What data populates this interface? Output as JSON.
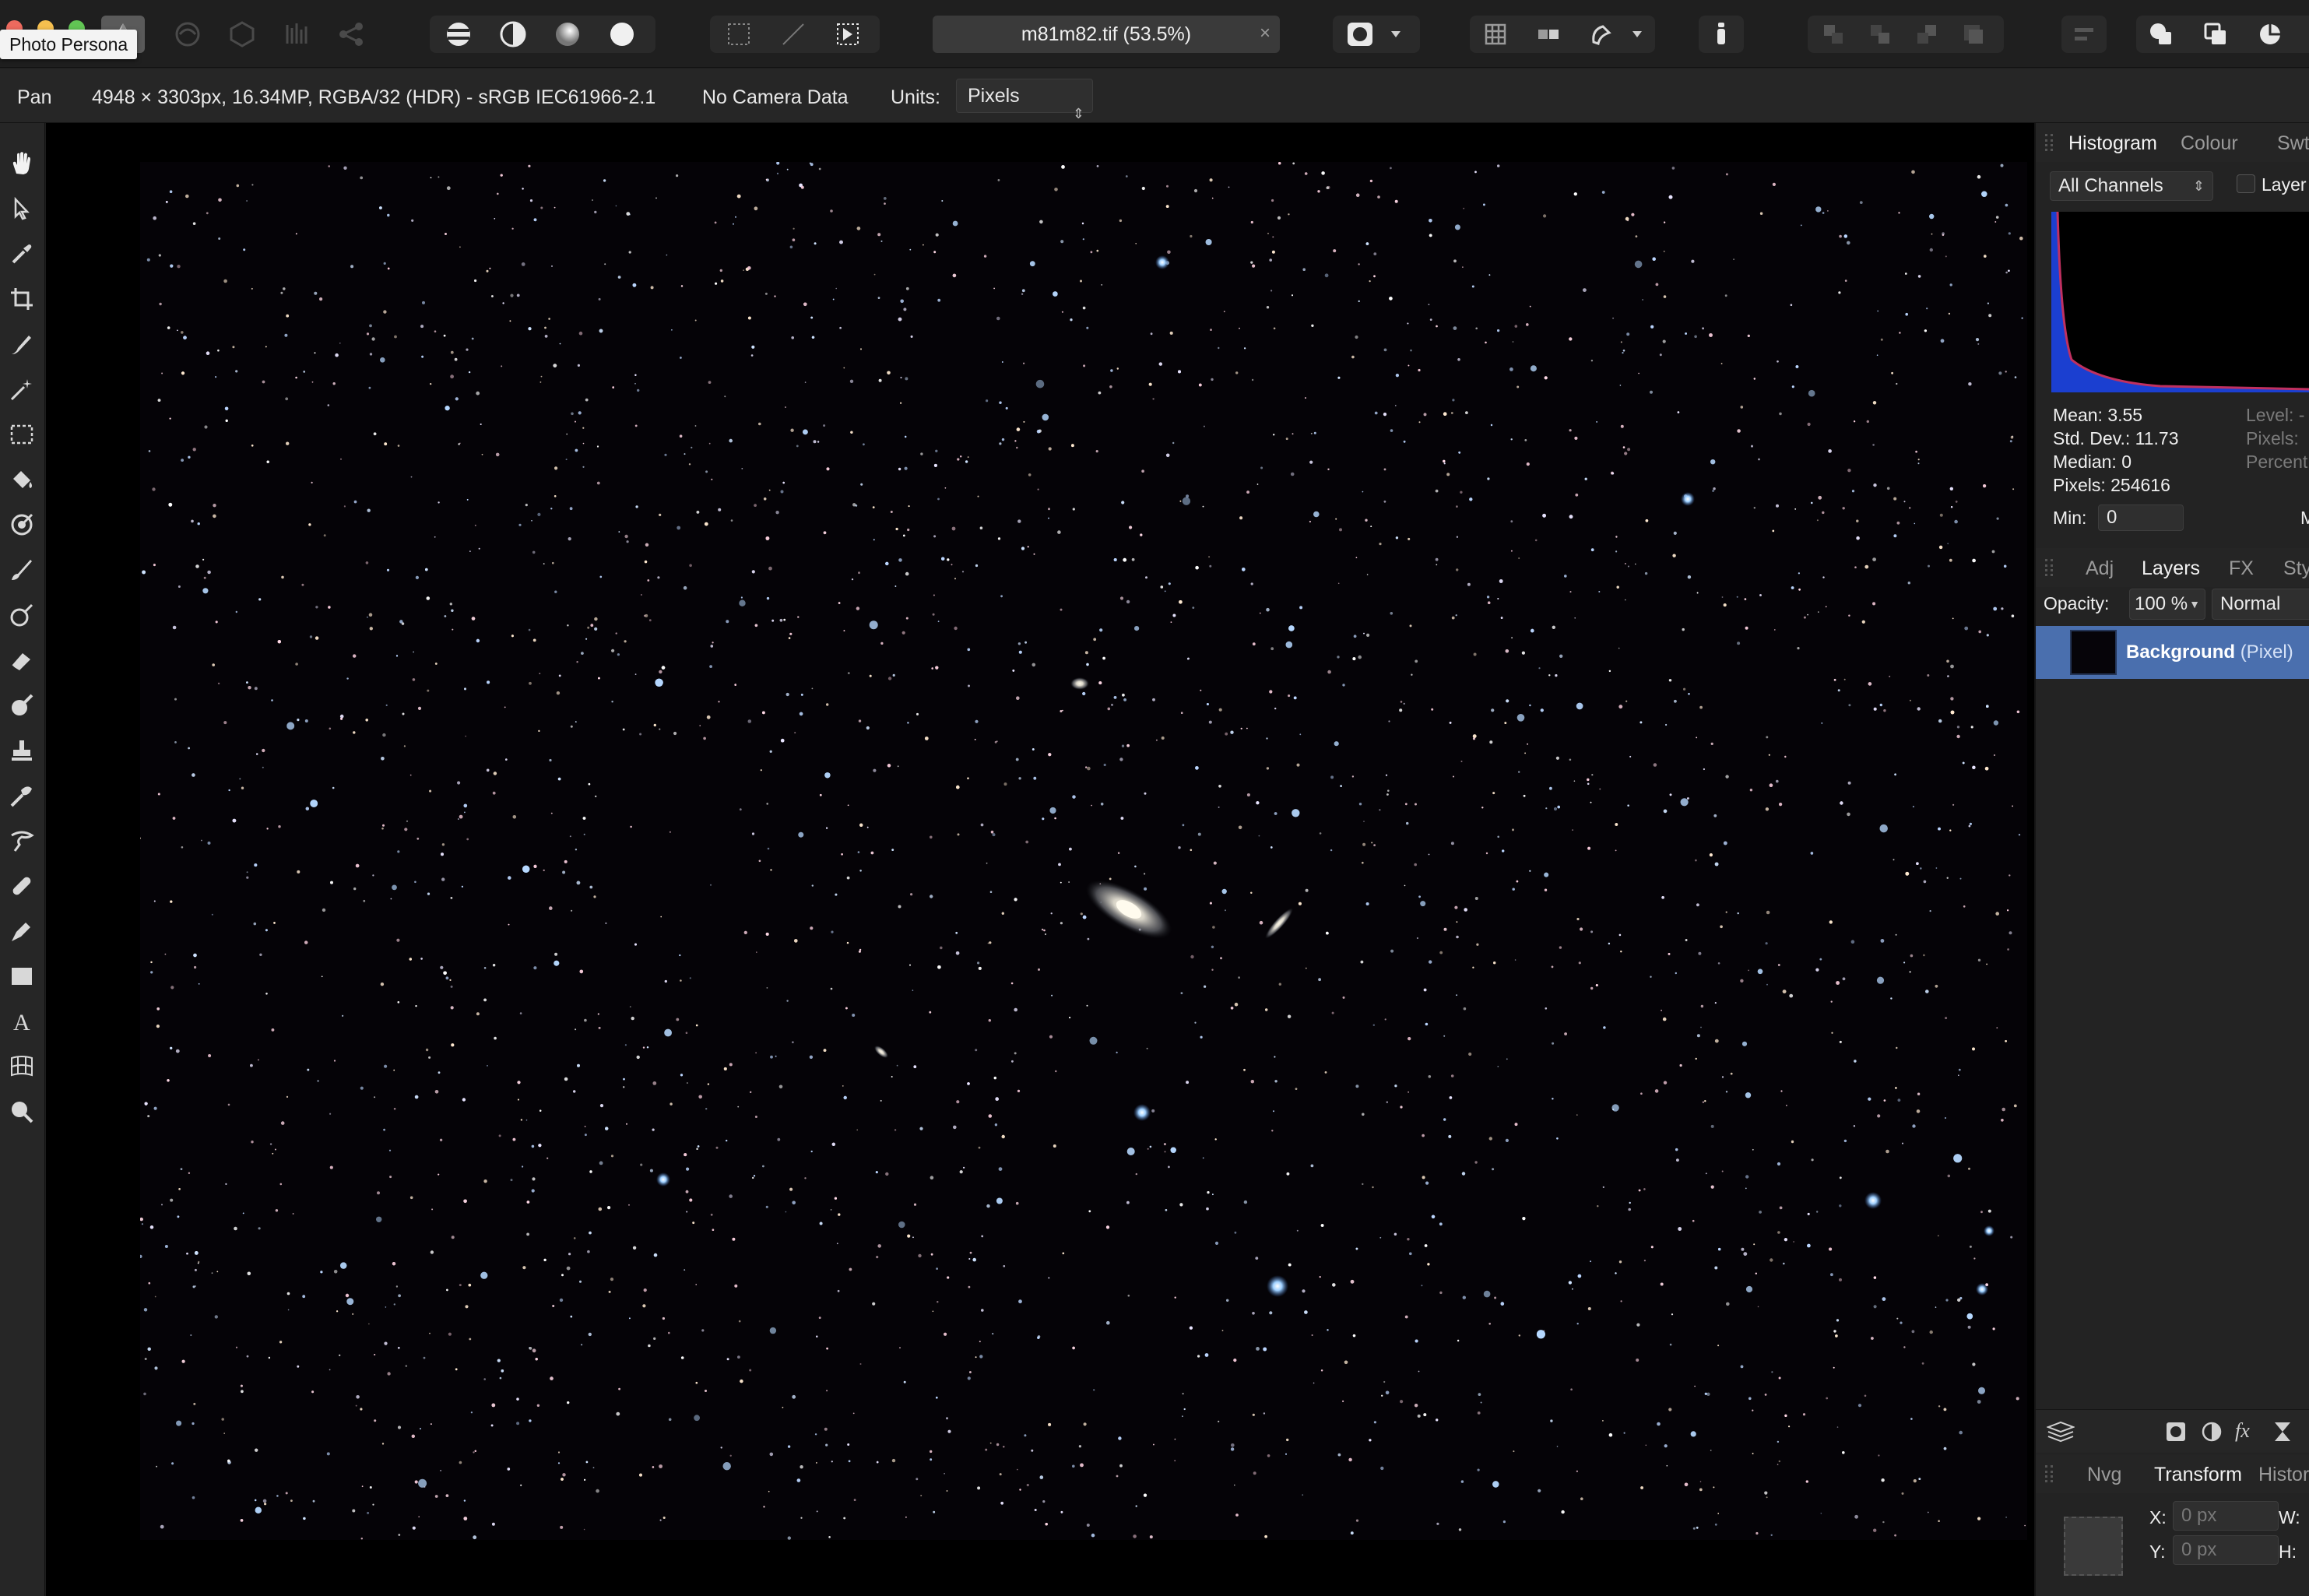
{
  "app": {
    "persona_label": "Photo Persona",
    "document_title": "m81m82.tif (53.5%)",
    "document_close": "×"
  },
  "context_bar": {
    "tool_name": "Pan",
    "image_info": "4948 × 3303px, 16.34MP, RGBA/32 (HDR) - sRGB IEC61966-2.1",
    "camera": "No Camera Data",
    "units_label": "Units:",
    "units_value": "Pixels"
  },
  "tools": [
    "hand-tool",
    "move-tool",
    "color-picker-tool",
    "crop-tool",
    "selection-brush-tool",
    "magic-wand-tool",
    "marquee-tool",
    "flood-fill-tool",
    "color-replace-tool",
    "paint-brush-tool",
    "dodge-tool",
    "erase-brush-tool",
    "blur-brush-tool",
    "clone-tool",
    "smudge-tool",
    "liquify-tool",
    "healing-brush-tool",
    "pen-tool",
    "rectangle-tool",
    "text-tool",
    "mesh-warp-tool",
    "zoom-tool"
  ],
  "histogram_panel": {
    "tabs": [
      "Histogram",
      "Colour",
      "Swt"
    ],
    "channel_select": "All Channels",
    "layer_checkbox_label": "Layer",
    "stats": {
      "mean": "Mean: 3.55",
      "std_dev": "Std. Dev.: 11.73",
      "median": "Median: 0",
      "pixels": "Pixels: 254616"
    },
    "right_stats": {
      "level": "Level: -",
      "pixels": "Pixels:",
      "percent": "Percent"
    },
    "min_label": "Min:",
    "min_value": "0",
    "max_label_partial": "M"
  },
  "layers_panel": {
    "tabs": [
      "Adj",
      "Layers",
      "FX",
      "Sty"
    ],
    "opacity_label": "Opacity:",
    "opacity_value": "100 %",
    "blend_mode": "Normal",
    "layer": {
      "name": "Background",
      "type": "(Pixel)"
    }
  },
  "transform_panel": {
    "tabs": [
      "Nvg",
      "Transform",
      "Histor"
    ],
    "x_label": "X:",
    "x_value": "0 px",
    "y_label": "Y:",
    "y_value": "0 px",
    "w_label": "W:",
    "h_label": "H:"
  },
  "colors": {
    "accent_selection": "#4a6fae",
    "panel_bg": "#232323",
    "canvas_bg": "#000000",
    "traffic_red": "#ed6a5e",
    "traffic_yellow": "#f5bf4f",
    "traffic_green": "#61c554"
  }
}
